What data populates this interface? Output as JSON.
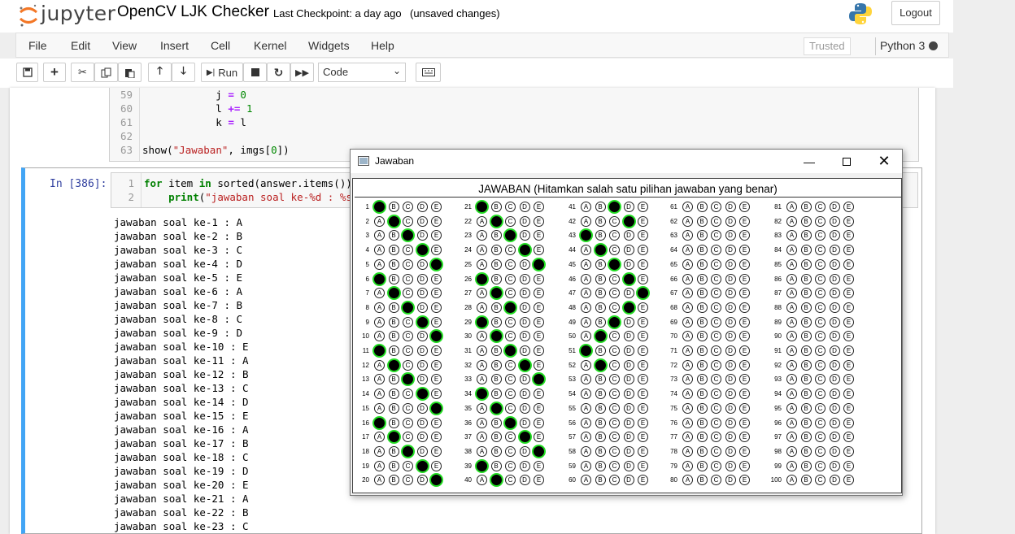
{
  "header": {
    "logo_text": "jupyter",
    "notebook_title": "OpenCV LJK Checker",
    "checkpoint": "Last Checkpoint: a day ago",
    "unsaved": "(unsaved changes)",
    "logout_label": "Logout"
  },
  "menubar": {
    "items": [
      "File",
      "Edit",
      "View",
      "Insert",
      "Cell",
      "Kernel",
      "Widgets",
      "Help"
    ],
    "trusted": "Trusted",
    "kernel": "Python 3"
  },
  "toolbar": {
    "run_label": "Run",
    "cell_type": "Code"
  },
  "cell1": {
    "line_numbers": [
      "59",
      "60",
      "61",
      "62",
      "63"
    ],
    "lines": [
      "            j = 0",
      "            l += 1",
      "            k = l",
      "",
      "show(\"Jawaban\", imgs[0])"
    ]
  },
  "cell2": {
    "prompt": "In [386]:",
    "line_numbers": [
      "1",
      "2"
    ],
    "lines": [
      "for item in sorted(answer.items()):",
      "    print(\"jawaban soal ke-%d : %s\" % item)"
    ],
    "output": [
      "jawaban soal ke-1 : A",
      "jawaban soal ke-2 : B",
      "jawaban soal ke-3 : C",
      "jawaban soal ke-4 : D",
      "jawaban soal ke-5 : E",
      "jawaban soal ke-6 : A",
      "jawaban soal ke-7 : B",
      "jawaban soal ke-8 : C",
      "jawaban soal ke-9 : D",
      "jawaban soal ke-10 : E",
      "jawaban soal ke-11 : A",
      "jawaban soal ke-12 : B",
      "jawaban soal ke-13 : C",
      "jawaban soal ke-14 : D",
      "jawaban soal ke-15 : E",
      "jawaban soal ke-16 : A",
      "jawaban soal ke-17 : B",
      "jawaban soal ke-18 : C",
      "jawaban soal ke-19 : D",
      "jawaban soal ke-20 : E",
      "jawaban soal ke-21 : A",
      "jawaban soal ke-22 : B",
      "jawaban soal ke-23 : C"
    ]
  },
  "cv_window": {
    "title": "Jawaban",
    "sheet_title": "JAWABAN (Hitamkan salah satu pilihan jawaban yang benar)",
    "options": [
      "A",
      "B",
      "C",
      "D",
      "E"
    ],
    "answers": [
      "A",
      "B",
      "C",
      "D",
      "E",
      "A",
      "B",
      "C",
      "D",
      "E",
      "A",
      "B",
      "C",
      "D",
      "E",
      "A",
      "B",
      "C",
      "D",
      "E",
      "A",
      "B",
      "C",
      "D",
      "E",
      "A",
      "B",
      "C",
      "A",
      "B",
      "C",
      "D",
      "E",
      "A",
      "B",
      "C",
      "D",
      "E",
      "A",
      "B",
      "C",
      "D",
      "A",
      "B",
      "C",
      "D",
      "E",
      "D",
      "C",
      "B",
      "A",
      "B",
      "",
      "",
      "",
      "",
      "",
      "",
      "",
      "",
      "",
      "",
      "",
      "",
      "",
      "",
      "",
      "",
      "",
      "",
      "",
      "",
      "",
      "",
      "",
      "",
      "",
      "",
      "",
      "",
      "",
      "",
      "",
      "",
      "",
      "",
      "",
      "",
      "",
      "",
      "",
      ""
    ]
  },
  "colors": {
    "accent": "#42a5f5",
    "detected": "#22dd22",
    "keyword": "#008000",
    "string": "#ba2121"
  }
}
